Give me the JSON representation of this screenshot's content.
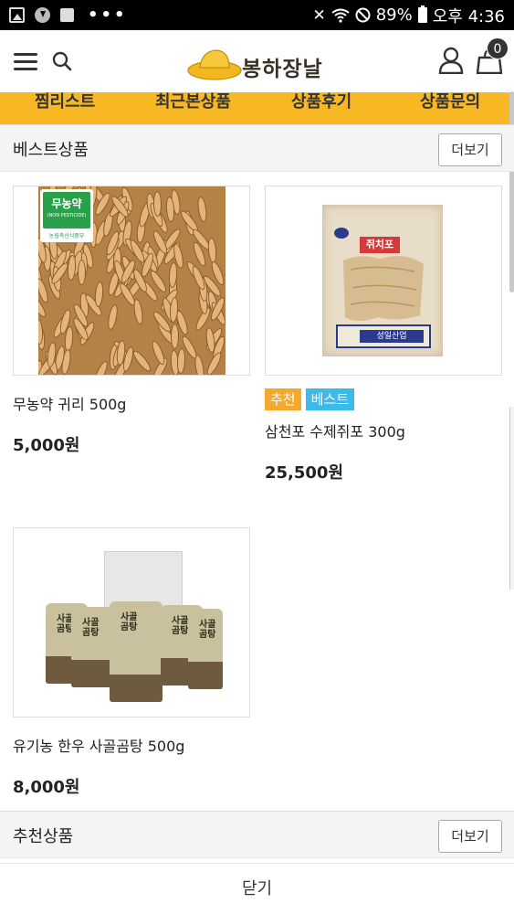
{
  "status_bar": {
    "battery": "89%",
    "time": "오후 4:36",
    "dots": "•••"
  },
  "header": {
    "logo_text": "봉하장날",
    "cart_count": "0",
    "icons": [
      "menu-icon",
      "search-icon",
      "user-icon",
      "cart-icon"
    ]
  },
  "tabs": [
    {
      "label": "찜리스트"
    },
    {
      "label": "최근본상품"
    },
    {
      "label": "상품후기"
    },
    {
      "label": "상품문의"
    }
  ],
  "best_section": {
    "title": "베스트상품",
    "more_label": "더보기",
    "products": [
      {
        "name": "무농약 귀리 500g",
        "price": "5,000원",
        "image_badge": "무농약",
        "image_badge_sub": "(NON PESTICIDE)",
        "image_badge_foot": "농림축산식품부"
      },
      {
        "name": "삼천포 수제쥐포 300g",
        "price": "25,500원",
        "badges": [
          "추천",
          "베스트"
        ],
        "pack_label": "쥐치포",
        "pack_brand": "성일산업"
      },
      {
        "name": "유기농 한우 사골곰탕 500g",
        "price": "8,000원",
        "pouch_label": "사골곰탕"
      }
    ]
  },
  "recommended_section": {
    "title": "추천상품",
    "more_label": "더보기"
  },
  "close_label": "닫기",
  "colors": {
    "tab_bar": "#f8b824",
    "badge_recommend": "#f6a82b",
    "badge_best": "#3dbbe8"
  }
}
